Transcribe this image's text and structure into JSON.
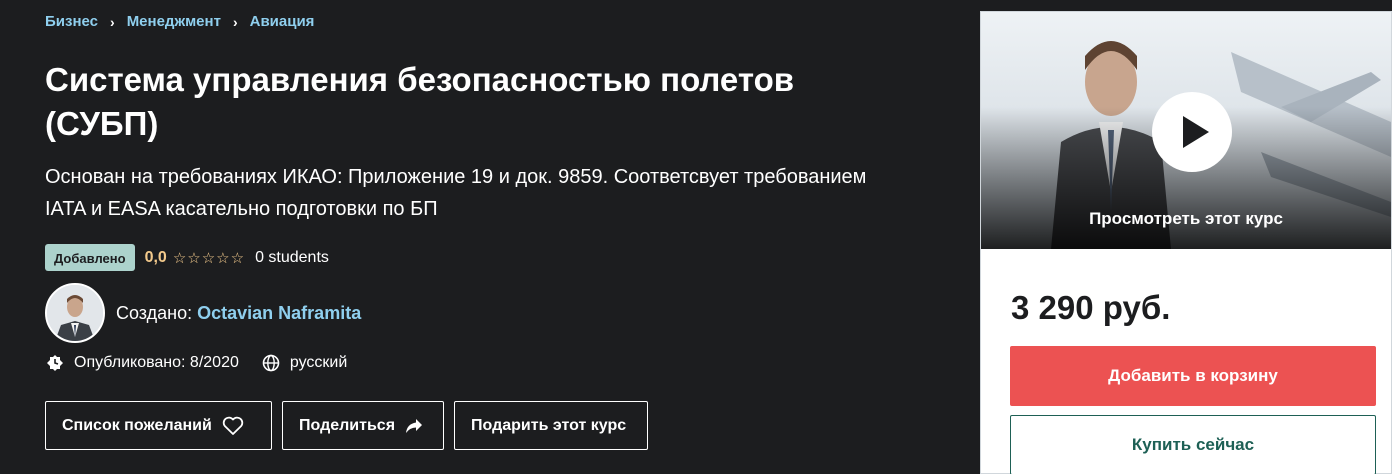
{
  "breadcrumb": [
    "Бизнес",
    "Менеджмент",
    "Авиация"
  ],
  "course": {
    "title": "Система управления безопасностью полетов (СУБП)",
    "subtitle": "Основан на требованиях ИКАО: Приложение 19 и док. 9859. Соответсвует требованием IATA и EASA касательно подготовки по БП",
    "badge": "Добавлено",
    "rating": "0,0",
    "stars": "☆☆☆☆☆",
    "students": "0 students",
    "created_label": "Создано:",
    "author": "Octavian Naframita",
    "published": "Опубликовано: 8/2020",
    "language": "русский"
  },
  "actions": {
    "wishlist": "Список пожеланий",
    "share": "Поделиться",
    "gift": "Подарить этот курс"
  },
  "card": {
    "preview_label": "Просмотреть этот курс",
    "price": "3 290 руб.",
    "add_to_cart": "Добавить в корзину",
    "buy_now": "Купить сейчас"
  },
  "colors": {
    "background": "#1c1d1f",
    "link": "#8fcfee",
    "rating": "#f3ca8c",
    "badge": "#acd2cc",
    "cart_button": "#ec5252",
    "buy_button": "#1e6055"
  }
}
